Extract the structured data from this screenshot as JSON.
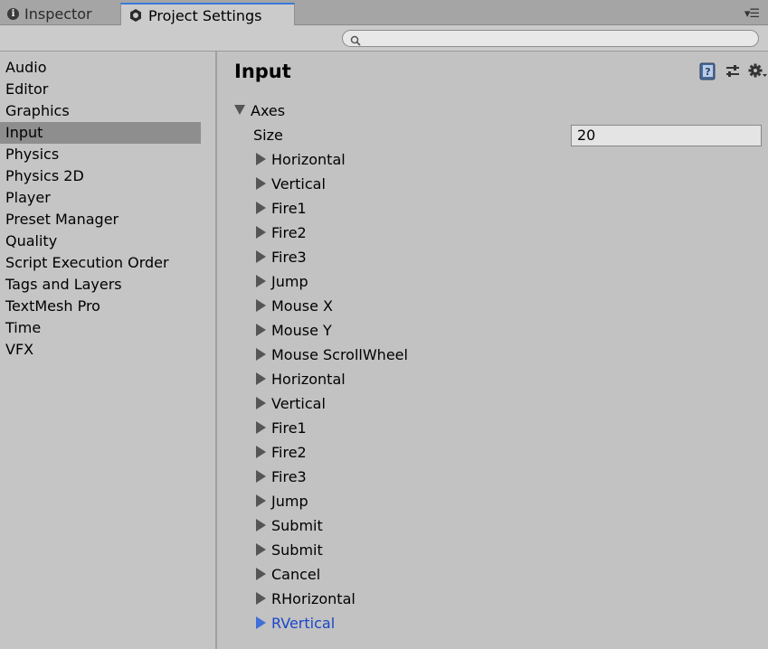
{
  "tabs": {
    "inspector": "Inspector",
    "project_settings": "Project Settings"
  },
  "search": {
    "placeholder": "",
    "value": ""
  },
  "sidebar": {
    "items": [
      {
        "label": "Audio"
      },
      {
        "label": "Editor"
      },
      {
        "label": "Graphics"
      },
      {
        "label": "Input",
        "selected": true
      },
      {
        "label": "Physics"
      },
      {
        "label": "Physics 2D"
      },
      {
        "label": "Player"
      },
      {
        "label": "Preset Manager"
      },
      {
        "label": "Quality"
      },
      {
        "label": "Script Execution Order"
      },
      {
        "label": "Tags and Layers"
      },
      {
        "label": "TextMesh Pro"
      },
      {
        "label": "Time"
      },
      {
        "label": "VFX"
      }
    ]
  },
  "main": {
    "title": "Input",
    "axes_label": "Axes",
    "size_label": "Size",
    "size_value": "20",
    "axes": [
      "Horizontal",
      "Vertical",
      "Fire1",
      "Fire2",
      "Fire3",
      "Jump",
      "Mouse X",
      "Mouse Y",
      "Mouse ScrollWheel",
      "Horizontal",
      "Vertical",
      "Fire1",
      "Fire2",
      "Fire3",
      "Jump",
      "Submit",
      "Submit",
      "Cancel",
      "RHorizontal",
      "RVertical"
    ],
    "highlighted_axis_index": 19
  },
  "colors": {
    "selection": "#8e8e8e",
    "highlight_text": "#1a45c9",
    "active_tab_accent": "#3c7ad6"
  }
}
